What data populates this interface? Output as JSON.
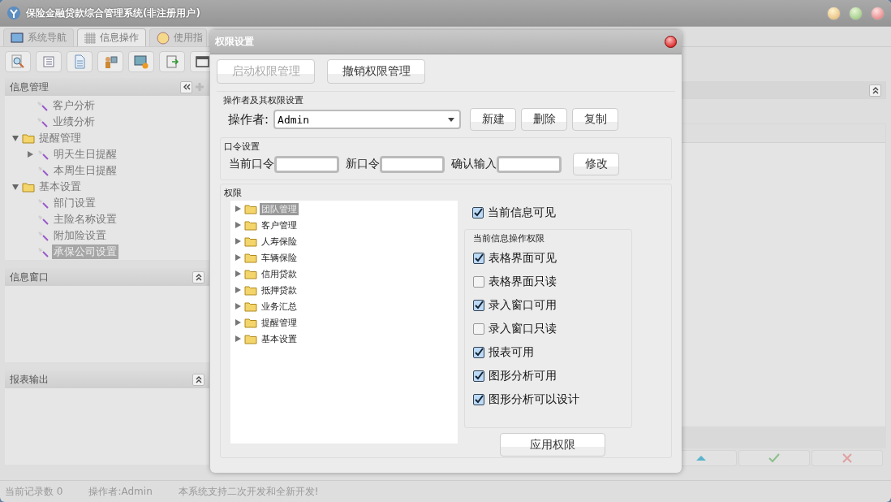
{
  "window": {
    "title": "保险金融贷款综合管理系统(非注册用户)"
  },
  "tabs": [
    {
      "label": "系统导航",
      "selected": false
    },
    {
      "label": "信息操作",
      "selected": true
    },
    {
      "label": "使用指",
      "selected": false
    }
  ],
  "sidebar": {
    "title": "信息管理",
    "continued_items": [
      {
        "label": "客户分析",
        "selected": false
      },
      {
        "label": "业绩分析",
        "selected": false
      }
    ],
    "items": [
      {
        "label": "提醒管理",
        "expanded": true,
        "selected": false,
        "children": [
          {
            "label": "明天生日提醒",
            "expanded": false,
            "selected": false
          },
          {
            "label": "本周生日提醒",
            "selected": false
          }
        ]
      },
      {
        "label": "基本设置",
        "expanded": true,
        "selected": false,
        "children": [
          {
            "label": "部门设置",
            "selected": false
          },
          {
            "label": "主险名称设置",
            "selected": false
          },
          {
            "label": "附加险设置",
            "selected": false
          },
          {
            "label": "承保公司设置",
            "selected": true
          }
        ]
      }
    ]
  },
  "panels": [
    {
      "title": "信息窗口"
    },
    {
      "title": "报表输出"
    }
  ],
  "status_bar": [
    "当前记录数 0",
    "操作者:Admin",
    "本系统支持二次开发和全新开发!"
  ],
  "dialog": {
    "title": "权限设置",
    "mode_buttons": [
      {
        "label": "启动权限管理",
        "disabled": true
      },
      {
        "label": "撤销权限管理",
        "disabled": false
      }
    ],
    "operator_section": {
      "title": "操作者及其权限设置",
      "label": "操作者:",
      "value": "Admin",
      "buttons": [
        "新建",
        "删除",
        "复制"
      ]
    },
    "password_section": {
      "title": "口令设置",
      "fields": [
        "当前口令",
        "新口令",
        "确认输入"
      ],
      "button": "修改"
    },
    "permission_section": {
      "title": "权限",
      "tree": [
        {
          "label": "团队管理",
          "selected": true
        },
        {
          "label": "客户管理",
          "selected": false
        },
        {
          "label": "人寿保险",
          "selected": false
        },
        {
          "label": "车辆保险",
          "selected": false
        },
        {
          "label": "信用贷款",
          "selected": false
        },
        {
          "label": "抵押贷款",
          "selected": false
        },
        {
          "label": "业务汇总",
          "selected": false
        },
        {
          "label": "提醒管理",
          "selected": false
        },
        {
          "label": "基本设置",
          "selected": false
        }
      ],
      "visible": {
        "label": "当前信息可见",
        "checked": true
      },
      "group_title": "当前信息操作权限",
      "options": [
        {
          "label": "表格界面可见",
          "checked": true
        },
        {
          "label": "表格界面只读",
          "checked": false
        },
        {
          "label": "录入窗口可用",
          "checked": true
        },
        {
          "label": "录入窗口只读",
          "checked": false
        },
        {
          "label": "报表可用",
          "checked": true
        },
        {
          "label": "图形分析可用",
          "checked": true
        },
        {
          "label": "图形分析可以设计",
          "checked": true
        }
      ],
      "apply_button": "应用权限"
    }
  }
}
